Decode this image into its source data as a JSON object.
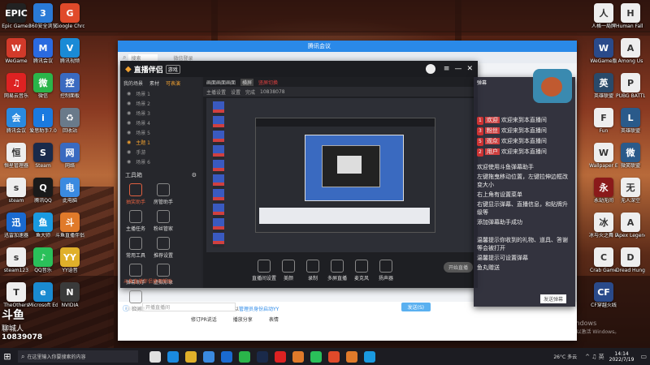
{
  "desktop": {
    "left_icons": [
      {
        "label": "Epic Games",
        "abbr": "EPIC",
        "color": "#222"
      },
      {
        "label": "360安全浏览器",
        "abbr": "3",
        "color": "#2a7ad6"
      },
      {
        "label": "Google Chrome",
        "abbr": "G",
        "color": "#e04a2a"
      },
      {
        "label": "WeGame",
        "abbr": "W",
        "color": "#d23a2a"
      },
      {
        "label": "腾讯会议",
        "abbr": "M",
        "color": "#2a6ae0"
      },
      {
        "label": "腾讯视频",
        "abbr": "V",
        "color": "#1a8ad6"
      },
      {
        "label": "网易云音乐",
        "abbr": "♫",
        "color": "#d22"
      },
      {
        "label": "微信",
        "abbr": "微",
        "color": "#2ab54a"
      },
      {
        "label": "控制面板",
        "abbr": "控",
        "color": "#3a6ac0"
      },
      {
        "label": "腾讯会议",
        "abbr": "会",
        "color": "#2a8ae0"
      },
      {
        "label": "爱思助手7.0",
        "abbr": "i",
        "color": "#1a7ae0"
      },
      {
        "label": "回收站",
        "abbr": "♻",
        "color": "#6a7a8a"
      },
      {
        "label": "恒星管理器",
        "abbr": "恒",
        "color": "#eee"
      },
      {
        "label": "Steam",
        "abbr": "S",
        "color": "#1a2a4a"
      },
      {
        "label": "网络",
        "abbr": "网",
        "color": "#3a6ac0"
      },
      {
        "label": "steam",
        "abbr": "s",
        "color": "#eee"
      },
      {
        "label": "腾讯QQ",
        "abbr": "Q",
        "color": "#1a1a1a"
      },
      {
        "label": "此电脑",
        "abbr": "电",
        "color": "#3a8ae0"
      },
      {
        "label": "迅雷加速器",
        "abbr": "迅",
        "color": "#1a6ad0"
      },
      {
        "label": "鱼大师",
        "abbr": "鱼",
        "color": "#1a9ae0"
      },
      {
        "label": "斗鱼直播伴侣",
        "abbr": "斗",
        "color": "#e07a2a"
      },
      {
        "label": "steam123",
        "abbr": "s",
        "color": "#eee"
      },
      {
        "label": "QQ音乐",
        "abbr": "♪",
        "color": "#2ac05a"
      },
      {
        "label": "YY语音",
        "abbr": "YY",
        "color": "#e0b02a"
      },
      {
        "label": "TheOthers",
        "abbr": "T",
        "color": "#eee"
      },
      {
        "label": "Microsoft Edge",
        "abbr": "e",
        "color": "#1a8ad0"
      },
      {
        "label": "NVIDIA",
        "abbr": "N",
        "color": "#3a3a3a"
      }
    ],
    "right_icons": [
      {
        "label": "人格一局牌",
        "abbr": "人",
        "color": "#eee"
      },
      {
        "label": "Human Fall Flat",
        "abbr": "H",
        "color": "#eee"
      },
      {
        "label": "WeGame版",
        "abbr": "W",
        "color": "#2a4a8a"
      },
      {
        "label": "Among Us",
        "abbr": "A",
        "color": "#eee"
      },
      {
        "label": "英雄联盟",
        "abbr": "英",
        "color": "#2a4a6a"
      },
      {
        "label": "PUBG BATTLEG...",
        "abbr": "P",
        "color": "#eee"
      },
      {
        "label": "Fun",
        "abbr": "F",
        "color": "#eee"
      },
      {
        "label": "英雄联盟",
        "abbr": "L",
        "color": "#2a5a8a"
      },
      {
        "label": "Wallpaper Engine",
        "abbr": "W",
        "color": "#eee"
      },
      {
        "label": "微笑联盟",
        "abbr": "微",
        "color": "#2a5a8a"
      },
      {
        "label": "永劫无间",
        "abbr": "永",
        "color": "#8a1a1a"
      },
      {
        "label": "无人深空",
        "abbr": "无",
        "color": "#eee"
      },
      {
        "label": "冰与火之舞 Dance of Fire",
        "abbr": "冰",
        "color": "#eee"
      },
      {
        "label": "Apex Legends",
        "abbr": "A",
        "color": "#eee"
      },
      {
        "label": "Crab Game",
        "abbr": "C",
        "color": "#eee"
      },
      {
        "label": "Dread Hunger",
        "abbr": "D",
        "color": "#eee"
      },
      {
        "label": "CF穿越火线",
        "abbr": "CF",
        "color": "#2a4a8a"
      }
    ]
  },
  "qq_window": {
    "title": "腾讯会议",
    "search_placeholder": "搜索",
    "status": "微信登录",
    "chat_hint": "检测到您可能正在浏览，建议回到音频设置。或以",
    "chat_link": "管理员身份启动YY",
    "footer_items": [
      "修订PR说话",
      "播放分享",
      "表情"
    ],
    "send_label": "发送(S)",
    "input_placeholder": "开播直播间"
  },
  "obs_app": {
    "brand": "直播伴侣",
    "version": "游戏",
    "nav_tabs": [
      "我的场景",
      "素材",
      "可表演"
    ],
    "scene_items": [
      "场景 1",
      "场景 2",
      "场景 3",
      "场景 4",
      "场景 5",
      "主题 1",
      "手游",
      "场景 6"
    ],
    "toolbox_title": "工具箱",
    "tools": [
      {
        "label": "抽奖助手"
      },
      {
        "label": "房管助手"
      },
      {
        "label": "主播任务"
      },
      {
        "label": "粉丝管家"
      },
      {
        "label": "常用工具"
      },
      {
        "label": "推荐设置"
      },
      {
        "label": "弹幕助手"
      },
      {
        "label": "虚拟形象"
      },
      {
        "label": "弹幕回复"
      }
    ],
    "bottom_hint": "斗鱼直播伴侣使用帮助",
    "preview_tabs": [
      "画面画面画面",
      "横屏",
      "竖屏切换"
    ],
    "preview_toolbar": [
      "主播设置",
      "设置",
      "完成",
      "10838078"
    ],
    "bottom_controls": [
      "直播间设置",
      "美颜",
      "录制",
      "多屏直播",
      "麦克风",
      "扬声器"
    ],
    "start_button": "开始直播"
  },
  "chat_panel": {
    "title": "弹幕",
    "messages": [
      {
        "badge": "1",
        "name": "欢迎",
        "text": "欢迎来到本直播间"
      },
      {
        "badge": "3",
        "name": "粉丝",
        "text": "欢迎来到本直播间"
      },
      {
        "badge": "5",
        "name": "观众",
        "text": "欢迎来到本直播间"
      },
      {
        "badge": "2",
        "name": "用户",
        "text": "欢迎来到本直播间"
      }
    ],
    "notice_lines": [
      "欢迎使用斗鱼弹幕助手",
      "左键拖曳移动位置，左键拉伸边框改变大小",
      "右上角有设置菜单",
      "右键显示弹幕、直播信息，和贴牌升级等",
      "添加弹幕助手成功"
    ],
    "tips": [
      "温馨提示你收到的礼物、道具、答谢等会被打开",
      "温馨提示可设置弹幕",
      "鱼丸赠送"
    ],
    "input_label": "发送弹幕"
  },
  "badge_overlay": {
    "brand": "斗鱼",
    "sub": "聊城人",
    "room": "10839078"
  },
  "watermark": {
    "line1": "激活 Windows",
    "line2": "转到\"设置\"以激活 Windows。"
  },
  "taskbar": {
    "search_placeholder": "在这里输入你要搜索的内容",
    "weather": "26°C 多云",
    "time": "14:14",
    "date": "2022/7/19",
    "app_colors": [
      "#e0e0e0",
      "#1a8ae0",
      "#e0b02a",
      "#3a8ae0",
      "#1a6ad0",
      "#2ab54a",
      "#1a2a4a",
      "#d22",
      "#e07a2a",
      "#2ac05a",
      "#e04a2a",
      "#e07a2a",
      "#1a9ae0"
    ]
  }
}
